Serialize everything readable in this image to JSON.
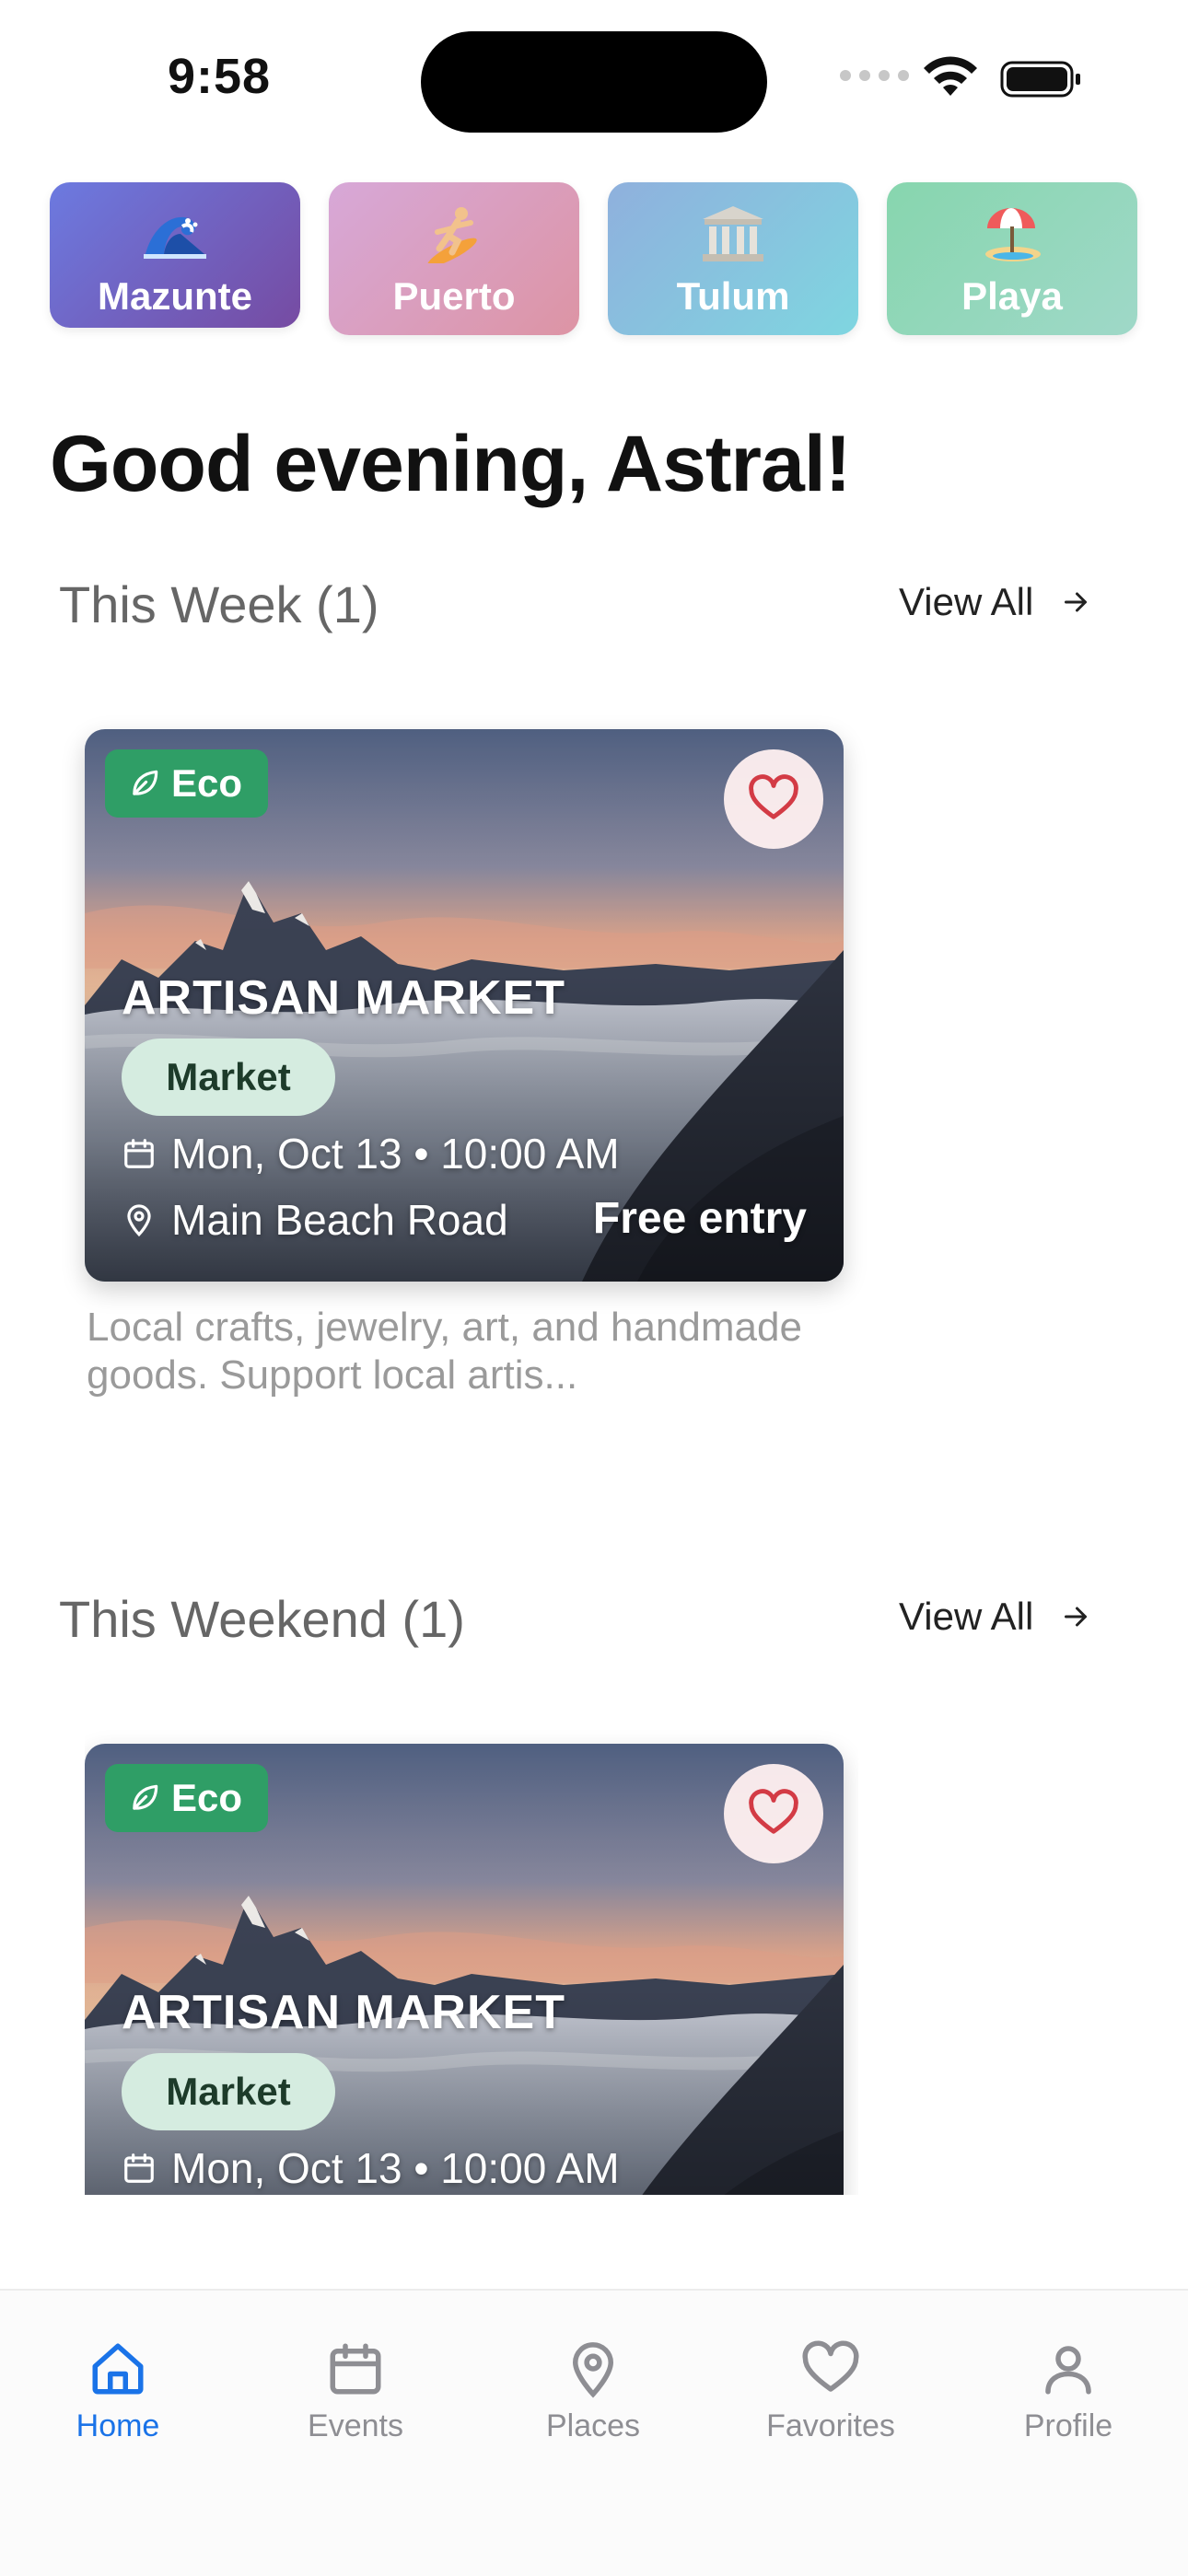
{
  "status_bar": {
    "time": "9:58"
  },
  "cities": [
    {
      "label": "Mazunte",
      "icon": "wave-icon"
    },
    {
      "label": "Puerto",
      "icon": "surfer-icon"
    },
    {
      "label": "Tulum",
      "icon": "temple-icon"
    },
    {
      "label": "Playa",
      "icon": "beach-umbrella-icon"
    }
  ],
  "greeting": "Good evening, Astral!",
  "sections": [
    {
      "title": "This Week (1)",
      "view_all": "View All",
      "event": {
        "badge": "Eco",
        "title": "ARTISAN MARKET",
        "category": "Market",
        "date": "Mon, Oct 13 • 10:00 AM",
        "location": "Main Beach Road",
        "price": "Free entry",
        "description": "Local crafts, jewelry, art, and handmade goods. Support local artis..."
      }
    },
    {
      "title": "This Weekend (1)",
      "view_all": "View All",
      "event": {
        "badge": "Eco",
        "title": "ARTISAN MARKET",
        "category": "Market",
        "date": "Mon, Oct 13 • 10:00 AM"
      }
    }
  ],
  "tabs": [
    {
      "label": "Home",
      "active": true
    },
    {
      "label": "Events",
      "active": false
    },
    {
      "label": "Places",
      "active": false
    },
    {
      "label": "Favorites",
      "active": false
    },
    {
      "label": "Profile",
      "active": false
    }
  ],
  "colors": {
    "accent": "#1a73e8",
    "eco": "#2f9e66",
    "heart": "#d33b45"
  }
}
